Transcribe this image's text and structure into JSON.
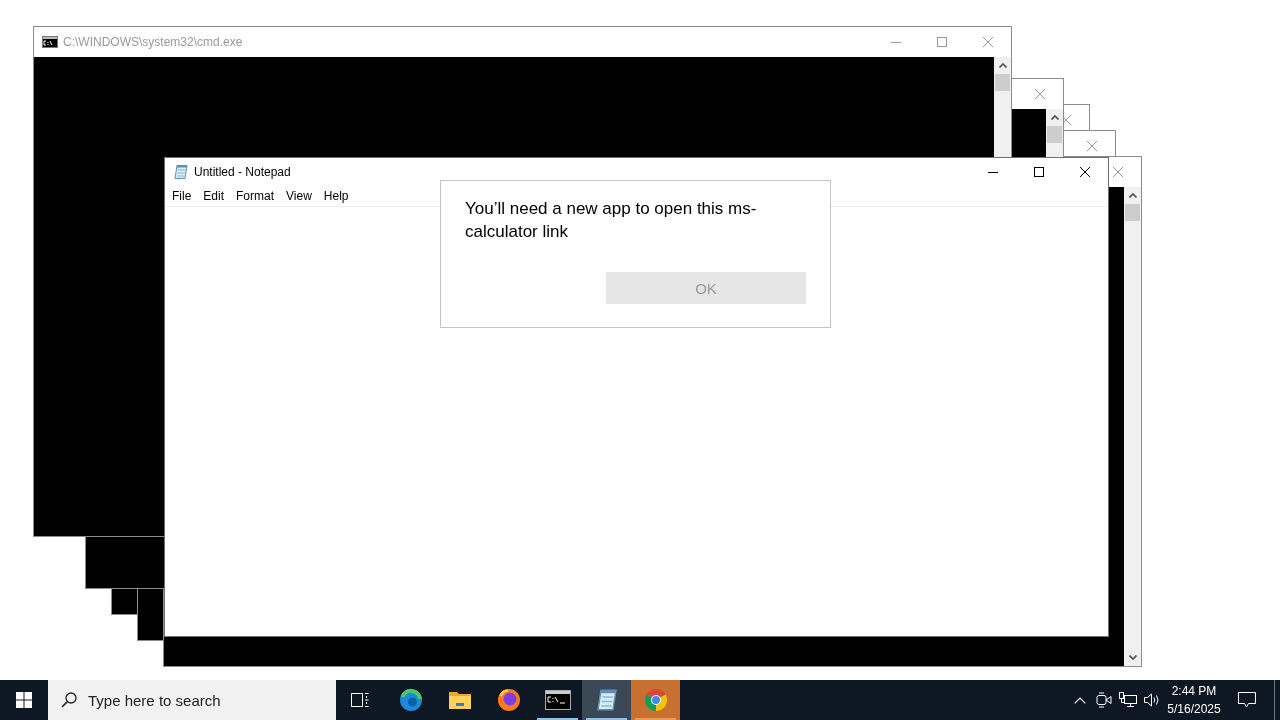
{
  "desktop": {
    "console_windows": [
      {
        "title": "C:\\WINDOWS\\system32\\cmd.exe",
        "active": false,
        "buttons": [
          {
            "kind": "minimize"
          },
          {
            "kind": "maximize"
          },
          {
            "kind": "close"
          }
        ],
        "scrollbar": {
          "arrows": [
            {
              "kind": "up"
            }
          ]
        }
      },
      {
        "active": false,
        "buttons": [
          {
            "kind": "close"
          }
        ],
        "scrollbar": {
          "arrows": [
            {
              "kind": "up"
            }
          ]
        }
      },
      {
        "active": false,
        "buttons": [
          {
            "kind": "close"
          }
        ]
      },
      {
        "active": false,
        "buttons": [
          {
            "kind": "close"
          }
        ]
      },
      {
        "active": false,
        "buttons": [
          {
            "kind": "close"
          }
        ],
        "scrollbar": {
          "arrows": [
            {
              "kind": "up"
            },
            {
              "kind": "down"
            }
          ]
        }
      }
    ],
    "notepad": {
      "title": "Untitled - Notepad",
      "active": true,
      "buttons": [
        {
          "kind": "minimize"
        },
        {
          "kind": "maximize"
        },
        {
          "kind": "close"
        }
      ],
      "menu": [
        "File",
        "Edit",
        "Format",
        "View",
        "Help"
      ]
    },
    "dialog": {
      "message": "You’ll need a new app to open this ms-calculator link",
      "button": {
        "label": "OK",
        "disabled": true
      }
    }
  },
  "taskbar": {
    "search": {
      "placeholder": "Type here to search"
    },
    "apps": [
      {
        "kind": "edge",
        "running": false,
        "active": false,
        "flashing": false
      },
      {
        "kind": "explorer",
        "running": false,
        "active": false,
        "flashing": false
      },
      {
        "kind": "firefox",
        "running": false,
        "active": false,
        "flashing": false
      },
      {
        "kind": "terminal",
        "running": true,
        "active": false,
        "flashing": false
      },
      {
        "kind": "notepad",
        "running": true,
        "active": true,
        "flashing": false
      },
      {
        "kind": "chrome",
        "running": true,
        "active": false,
        "flashing": true
      }
    ],
    "clock": {
      "time": "2:44 PM",
      "date": "5/16/2025"
    }
  }
}
